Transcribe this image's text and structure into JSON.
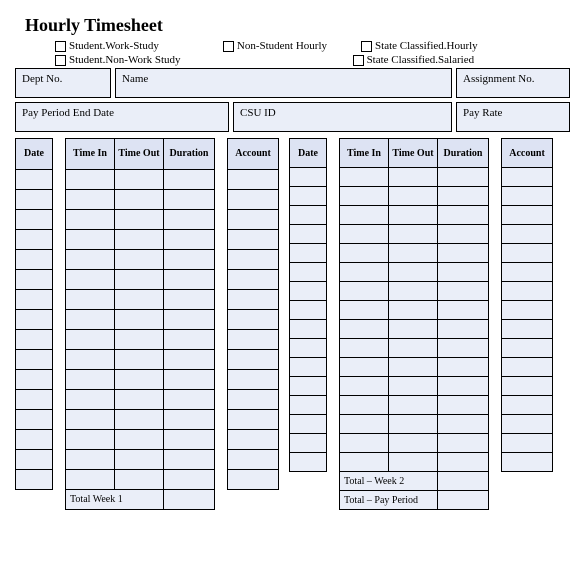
{
  "title": "Hourly Timesheet",
  "checks": {
    "sws": "Student.Work-Study",
    "snws": "Student.Non-Work Study",
    "nsh": "Non-Student Hourly",
    "sch": "State Classified.Hourly",
    "scs": "State Classified.Salaried"
  },
  "fields": {
    "dept": "Dept No.",
    "name": "Name",
    "assign": "Assignment No.",
    "payperiod": "Pay Period End Date",
    "csuid": "CSU ID",
    "payrate": "Pay Rate"
  },
  "headers": {
    "date": "Date",
    "timein": "Time In",
    "timeout": "Time Out",
    "duration": "Duration",
    "account": "Account"
  },
  "totals": {
    "week1": "Total Week 1",
    "week2": "Total – Week 2",
    "payperiod": "Total – Pay Period"
  },
  "rows": 16
}
